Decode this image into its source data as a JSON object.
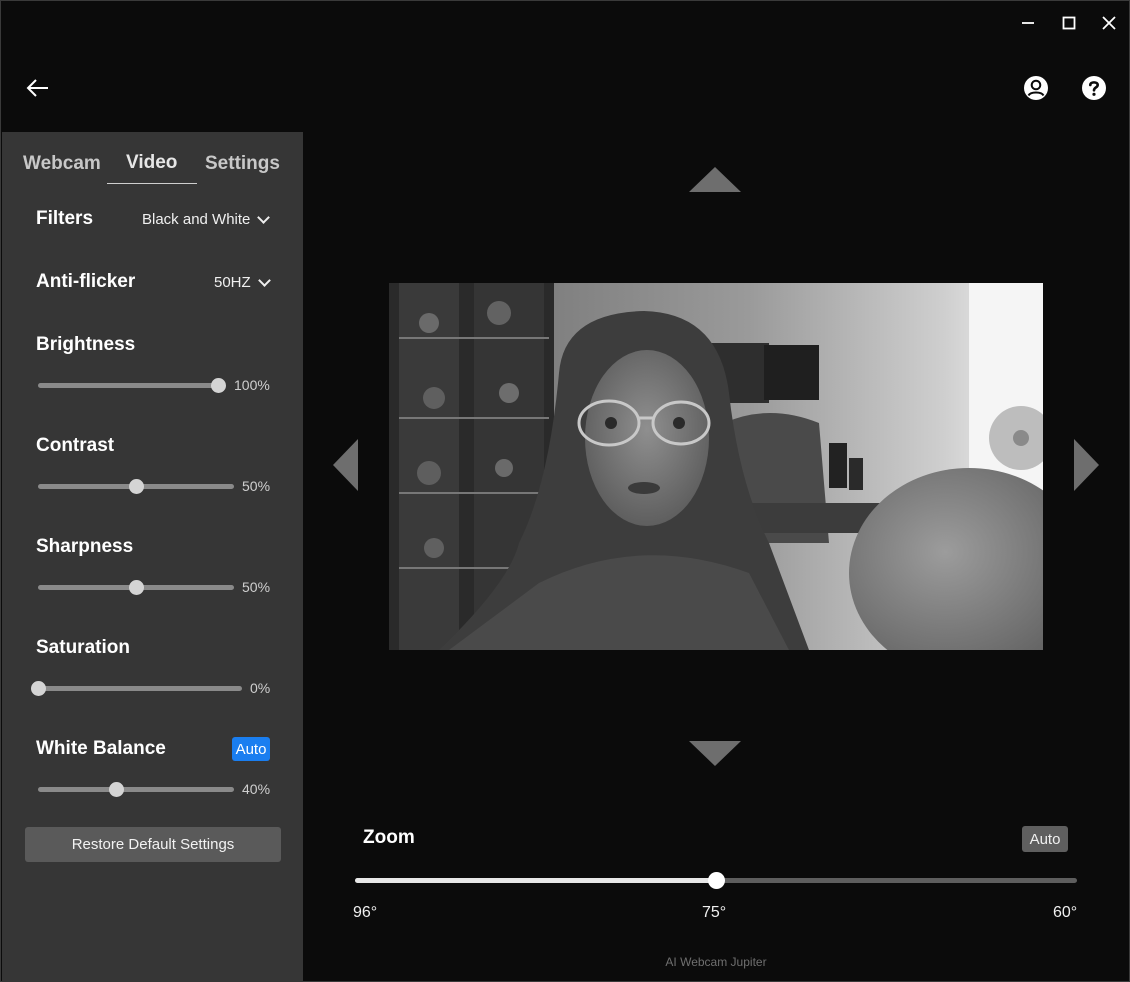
{
  "window": {
    "icons": {
      "minimize": "minimize-icon",
      "maximize": "maximize-icon",
      "close": "close-icon"
    }
  },
  "header": {
    "back_icon": "arrow-left-icon",
    "account_icon": "account-icon",
    "help_icon": "help-icon"
  },
  "sidebar": {
    "tabs": [
      {
        "label": "Webcam",
        "active": false
      },
      {
        "label": "Video",
        "active": true
      },
      {
        "label": "Settings",
        "active": false
      }
    ],
    "filters": {
      "label": "Filters",
      "value": "Black and White"
    },
    "anti_flicker": {
      "label": "Anti-flicker",
      "value": "50HZ"
    },
    "brightness": {
      "label": "Brightness",
      "value": 100,
      "display": "100%"
    },
    "contrast": {
      "label": "Contrast",
      "value": 50,
      "display": "50%"
    },
    "sharpness": {
      "label": "Sharpness",
      "value": 50,
      "display": "50%"
    },
    "saturation": {
      "label": "Saturation",
      "value": 0,
      "display": "0%"
    },
    "white_balance": {
      "label": "White Balance",
      "auto_label": "Auto",
      "value": 40,
      "display": "40%"
    },
    "restore_label": "Restore Default Settings"
  },
  "main": {
    "zoom": {
      "label": "Zoom",
      "auto_label": "Auto",
      "value_fraction": 0.5,
      "ticks": [
        "96°",
        "75°",
        "60°"
      ]
    },
    "footer": "AI Webcam Jupiter"
  },
  "colors": {
    "accent": "#1a7ef0",
    "background": "#0b0b0b",
    "sidebar": "#363636"
  }
}
